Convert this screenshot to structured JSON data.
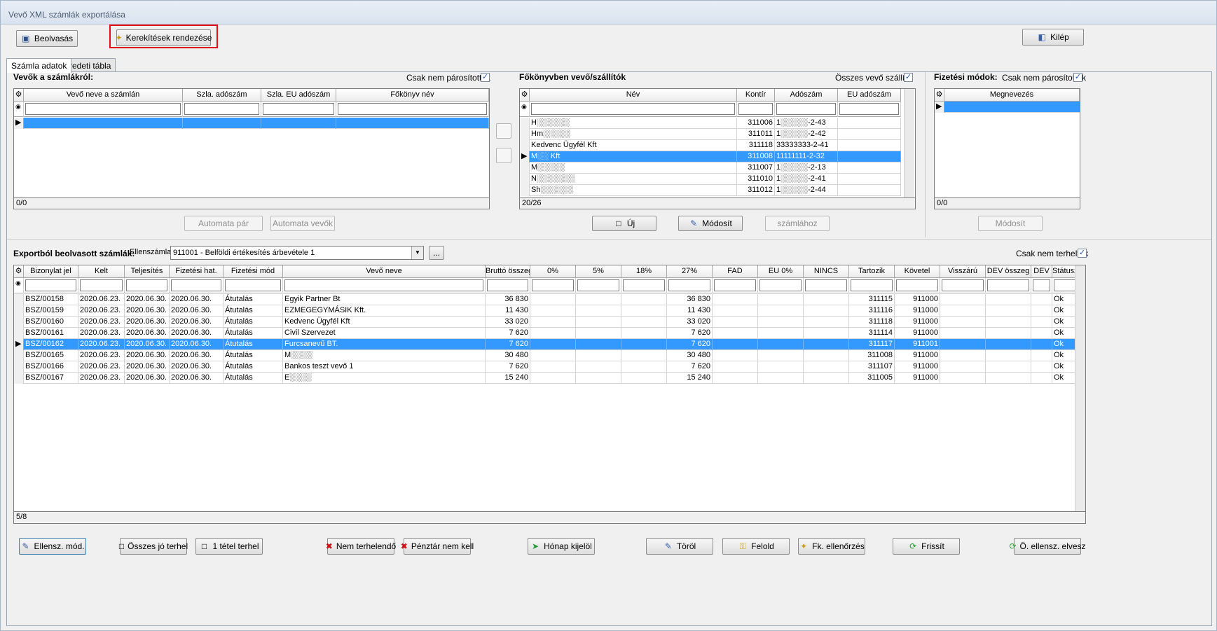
{
  "window": {
    "title": "Vevő XML számlák exportálása"
  },
  "toolbar": {
    "read": "Beolvasás",
    "rounding": "Kerekítések rendezése",
    "exit": "Kilép"
  },
  "tabs": [
    "Számla adatok",
    "Eredeti tábla"
  ],
  "customers": {
    "title": "Vevők a számlákról:",
    "only_unpaired": "Csak nem párosítottak",
    "columns": [
      "Vevő neve a számlán",
      "Szla. adószám",
      "Szla. EU adószám",
      "Főkönyv név"
    ],
    "footer": "0/0",
    "btn_auto_pair": "Automata pár",
    "btn_auto_customer": "Automata vevők"
  },
  "ledger": {
    "title": "Főkönyvben vevő/szállítók",
    "all_label": "Összes vevő szállító",
    "columns": [
      "Név",
      "Kontír",
      "Adószám",
      "EU adószám"
    ],
    "rows": [
      [
        "H░░░░░░",
        "311006",
        "1░░░░░-2-43"
      ],
      [
        "Hm░░░░░",
        "311011",
        "1░░░░░-2-42"
      ],
      [
        "Kedvenc Ügyfél Kft",
        "311118",
        "33333333-2-41"
      ],
      [
        "M░░ Kft",
        "311008",
        "11111111-2-32"
      ],
      [
        "M░░░░░",
        "311007",
        "1░░░░░-2-13"
      ],
      [
        "N░░░░░░░",
        "311010",
        "1░░░░░-2-41"
      ],
      [
        "Sh░░░░░░",
        "311012",
        "1░░░░░-2-44"
      ]
    ],
    "footer": "20/26",
    "btn_new": "Új",
    "btn_modify": "Módosít",
    "btn_to_invoice": "számlához"
  },
  "payment": {
    "title": "Fizetési módok:",
    "only_unpaired": "Csak nem párosítottak",
    "columns": [
      "Megnevezés"
    ],
    "footer": "0/0",
    "btn_modify": "Módosít"
  },
  "export": {
    "title": "Exportból beolvasott számlák:",
    "counter_label": "Ellenszámla:",
    "counter_value": "911001 - Belföldi értékesítés árbevétele 1",
    "browse": "...",
    "only_not_charged": "Csak nem terheltek",
    "columns": [
      "Bizonylat jel",
      "Kelt",
      "Teljesítés",
      "Fizetési hat.",
      "Fizetési mód",
      "Vevő neve",
      "Bruttó összeg",
      "0%",
      "5%",
      "18%",
      "27%",
      "FAD",
      "EU 0%",
      "NINCS",
      "Tartozik",
      "Követel",
      "Visszárú",
      "DEV összeg",
      "DEV",
      "Státusz"
    ],
    "rows": [
      [
        "BSZ/00158",
        "2020.06.23.",
        "2020.06.30.",
        "2020.06.30.",
        "Átutalás",
        "Egyik Partner Bt",
        "36 830",
        "36 830",
        "311115",
        "911000",
        "Ok"
      ],
      [
        "BSZ/00159",
        "2020.06.23.",
        "2020.06.30.",
        "2020.06.30.",
        "Átutalás",
        "EZMEGEGYMÁSIK Kft.",
        "11 430",
        "11 430",
        "311116",
        "911000",
        "Ok"
      ],
      [
        "BSZ/00160",
        "2020.06.23.",
        "2020.06.30.",
        "2020.06.30.",
        "Átutalás",
        "Kedvenc Ügyfél Kft",
        "33 020",
        "33 020",
        "311118",
        "911000",
        "Ok"
      ],
      [
        "BSZ/00161",
        "2020.06.23.",
        "2020.06.30.",
        "2020.06.30.",
        "Átutalás",
        "Civil Szervezet",
        "7 620",
        "7 620",
        "311114",
        "911000",
        "Ok"
      ],
      [
        "BSZ/00162",
        "2020.06.23.",
        "2020.06.30.",
        "2020.06.30.",
        "Átutalás",
        "Furcsanevű BT.",
        "7 620",
        "7 620",
        "311117",
        "911001",
        "Ok"
      ],
      [
        "BSZ/00165",
        "2020.06.23.",
        "2020.06.30.",
        "2020.06.30.",
        "Átutalás",
        "M░░░░",
        "30 480",
        "30 480",
        "311008",
        "911000",
        "Ok"
      ],
      [
        "BSZ/00166",
        "2020.06.23.",
        "2020.06.30.",
        "2020.06.30.",
        "Átutalás",
        "Bankos teszt vevő 1",
        "7 620",
        "7 620",
        "311107",
        "911000",
        "Ok"
      ],
      [
        "BSZ/00167",
        "2020.06.23.",
        "2020.06.30.",
        "2020.06.30.",
        "Átutalás",
        "E░░░░",
        "15 240",
        "15 240",
        "311005",
        "911000",
        "Ok"
      ]
    ],
    "footer": "5/8"
  },
  "bottom": {
    "counter_mod": "Ellensz. mód.",
    "all_good": "Összes jó terhel",
    "one_item": "1 tétel terhel",
    "not_charge": "Nem terhelendő",
    "no_cash": "Pénztár nem kell",
    "month_select": "Hónap kijelöl",
    "delete": "Töröl",
    "upload": "Felold",
    "check": "Fk. ellenőrzés",
    "refresh": "Frissít",
    "drop": "Ö. ellensz. elvesz"
  },
  "colors": {
    "selection": "#3399ff",
    "highlight": "#e0101a"
  }
}
